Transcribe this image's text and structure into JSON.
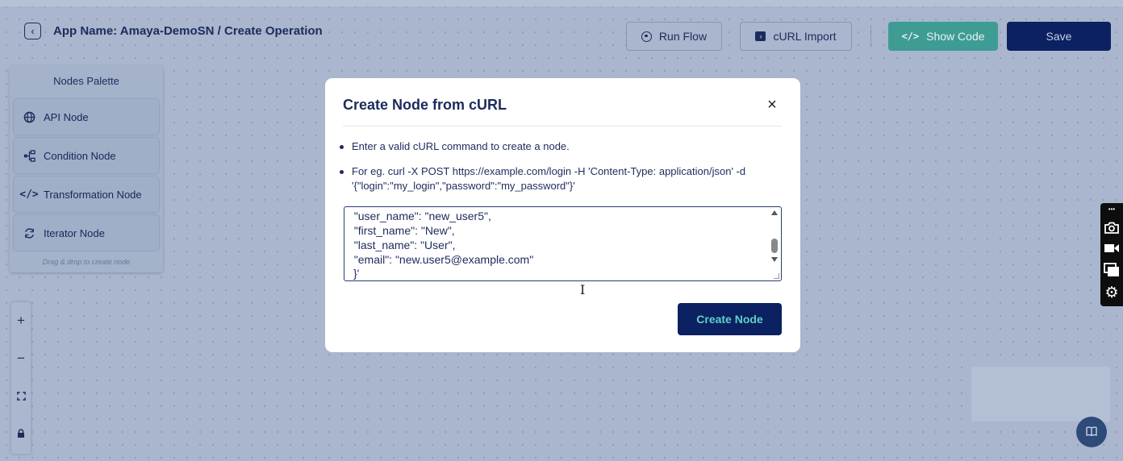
{
  "header": {
    "back_icon": "chevron-left-icon",
    "app_title": "App Name: Amaya-DemoSN / Create Operation",
    "buttons": {
      "run_flow": "Run Flow",
      "curl_import": "cURL Import",
      "show_code": "Show Code",
      "save": "Save"
    }
  },
  "palette": {
    "title": "Nodes Palette",
    "items": [
      {
        "label": "API Node",
        "icon": "globe-icon"
      },
      {
        "label": "Condition Node",
        "icon": "branch-icon"
      },
      {
        "label": "Transformation Node",
        "icon": "code-icon"
      },
      {
        "label": "Iterator Node",
        "icon": "loop-icon"
      }
    ],
    "hint": "Drag & drop to create node"
  },
  "zoom": {
    "zoom_in": "+",
    "zoom_out": "−",
    "fit": "⛶",
    "lock": "🔒"
  },
  "modal": {
    "title": "Create Node from cURL",
    "close": "×",
    "instructions": [
      "Enter a valid cURL command to create a node.",
      "For eg. curl -X POST https://example.com/login -H 'Content-Type: application/json' -d '{\"login\":\"my_login\",\"password\":\"my_password\"}'"
    ],
    "textarea_lines": [
      "  \"user_name\": \"new_user5\",",
      "  \"first_name\": \"New\",",
      "  \"last_name\": \"User\",",
      "  \"email\": \"new.user5@example.com\"",
      "}'"
    ],
    "create_button": "Create Node"
  },
  "colors": {
    "canvas_bg": "#a9b6cd",
    "primary": "#0b2161",
    "teal": "#3f9c95",
    "create_text": "#5fd0c7"
  }
}
